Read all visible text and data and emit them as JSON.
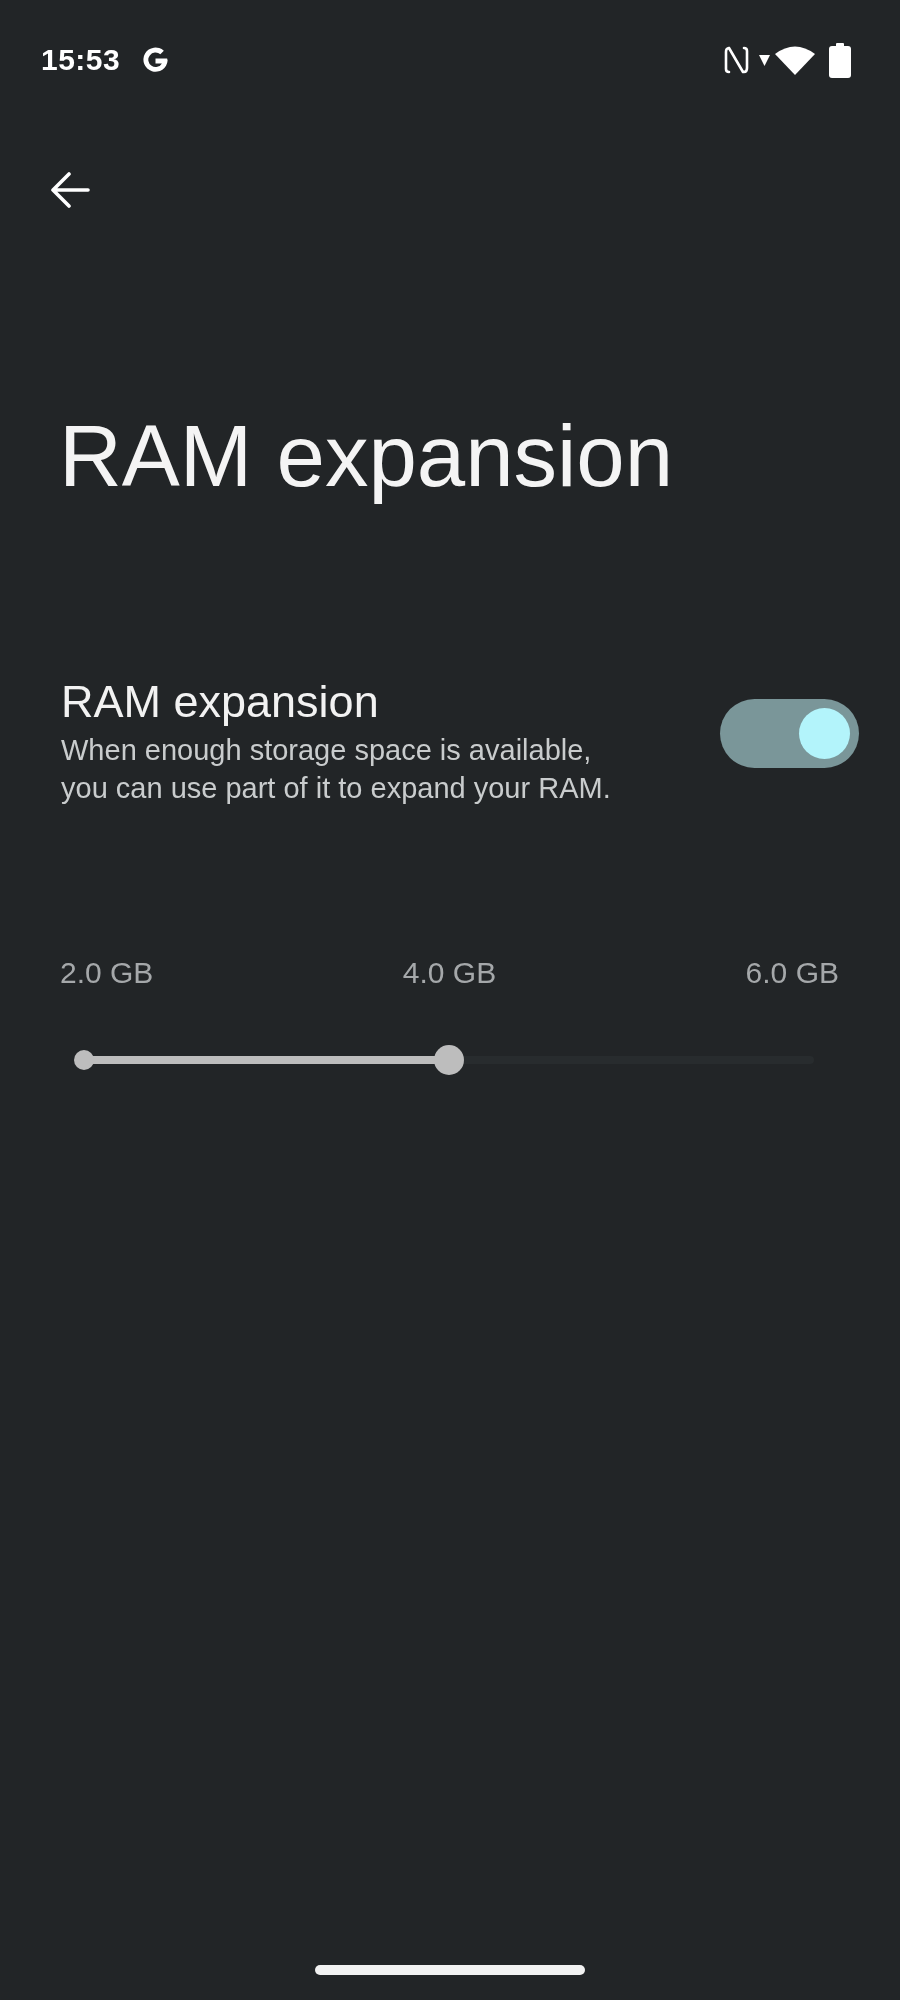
{
  "status_bar": {
    "time": "15:53"
  },
  "title": "RAM expansion",
  "setting": {
    "title": "RAM expansion",
    "description": "When enough storage space is available, you can use part of it to expand your RAM.",
    "on": true
  },
  "slider": {
    "labels": [
      "2.0 GB",
      "4.0 GB",
      "6.0 GB"
    ],
    "level": 0.5
  }
}
